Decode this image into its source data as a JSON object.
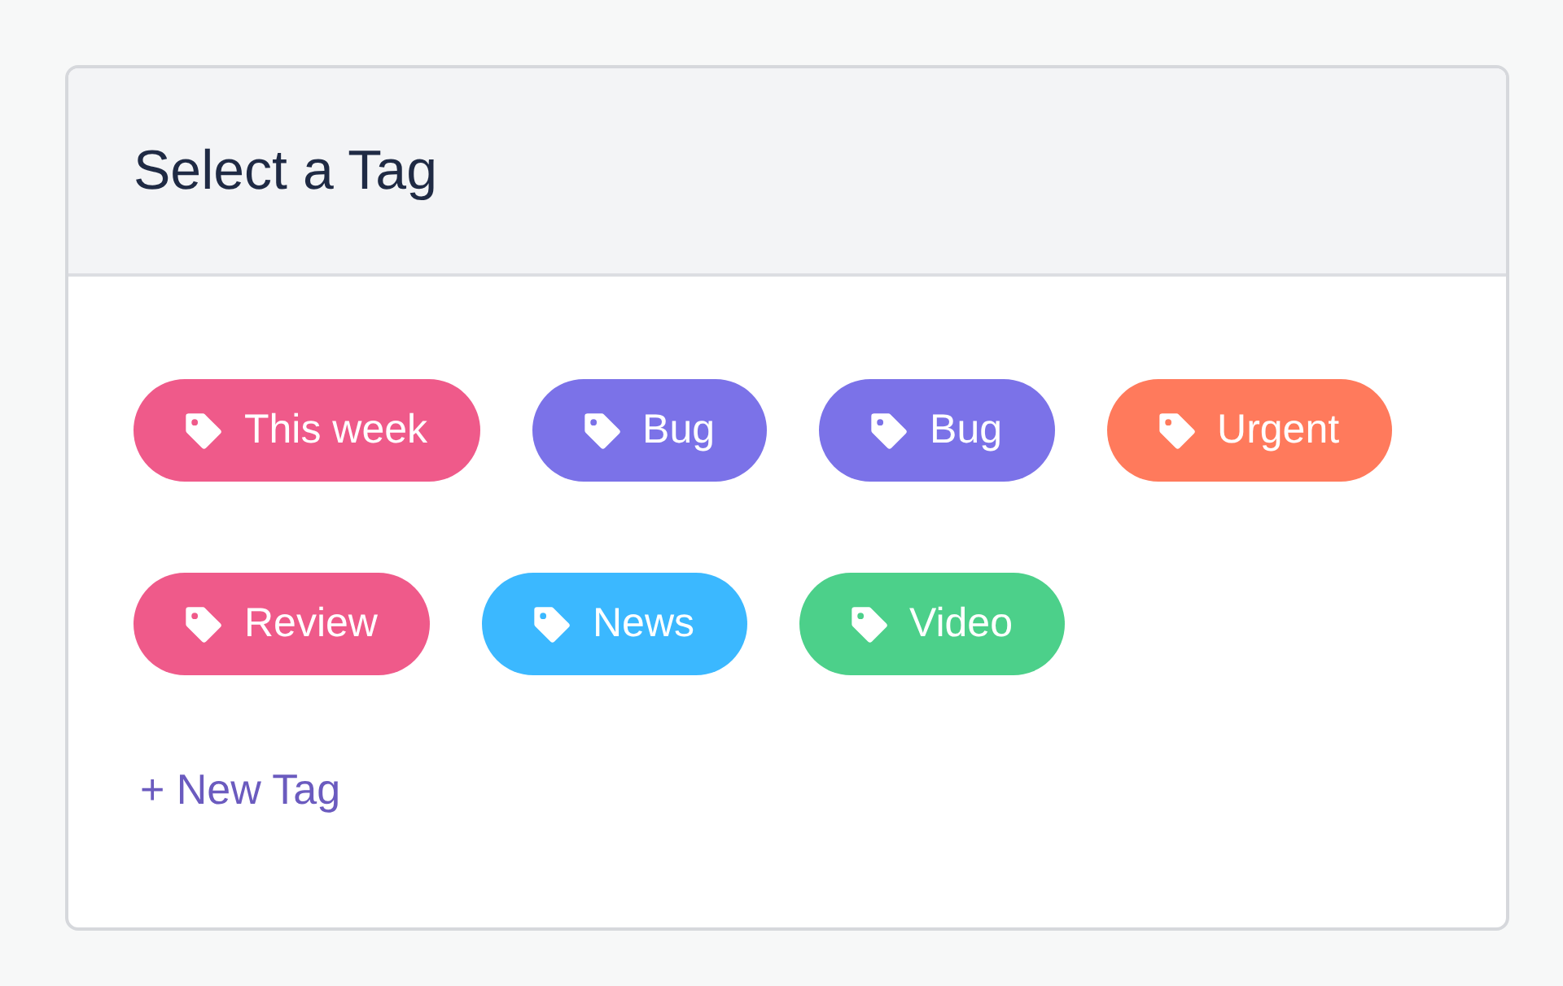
{
  "card": {
    "title": "Select a Tag"
  },
  "tags": [
    {
      "label": "This week",
      "color": "#ef5a8a"
    },
    {
      "label": "Bug",
      "color": "#7b72e8"
    },
    {
      "label": "Bug",
      "color": "#7b72e8"
    },
    {
      "label": "Urgent",
      "color": "#ff7a5c"
    },
    {
      "label": "Review",
      "color": "#ef5a8a"
    },
    {
      "label": "News",
      "color": "#3bb8ff"
    },
    {
      "label": "Video",
      "color": "#4cd08a"
    }
  ],
  "new_tag_link": "+ New Tag"
}
